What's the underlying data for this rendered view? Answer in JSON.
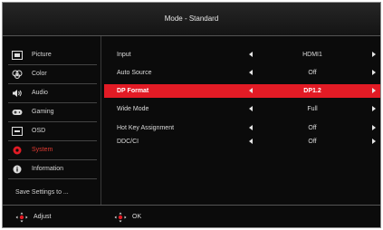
{
  "header": {
    "title": "Mode - Standard"
  },
  "sidebar": {
    "items": [
      {
        "label": "Picture",
        "icon": "picture-icon"
      },
      {
        "label": "Color",
        "icon": "color-icon"
      },
      {
        "label": "Audio",
        "icon": "speaker-icon"
      },
      {
        "label": "Gaming",
        "icon": "gamepad-icon"
      },
      {
        "label": "OSD",
        "icon": "osd-icon"
      },
      {
        "label": "System",
        "icon": "gear-icon",
        "active": true
      },
      {
        "label": "Information",
        "icon": "info-icon"
      }
    ],
    "save_label": "Save Settings to ..."
  },
  "settings": [
    {
      "label": "Input",
      "value": "HDMI1"
    },
    {
      "label": "Auto Source",
      "value": "Off"
    },
    {
      "label": "DP Format",
      "value": "DP1.2",
      "selected": true
    },
    {
      "label": "Wide Mode",
      "value": "Full"
    },
    {
      "label": "Hot Key Assignment",
      "value": "Off"
    },
    {
      "label": "DDC/CI",
      "value": "Off"
    }
  ],
  "footer": {
    "adjust_label": "Adjust",
    "ok_label": "OK"
  },
  "colors": {
    "accent": "#e21b25",
    "background": "#0b0b0b",
    "text": "#dcdcdc"
  }
}
